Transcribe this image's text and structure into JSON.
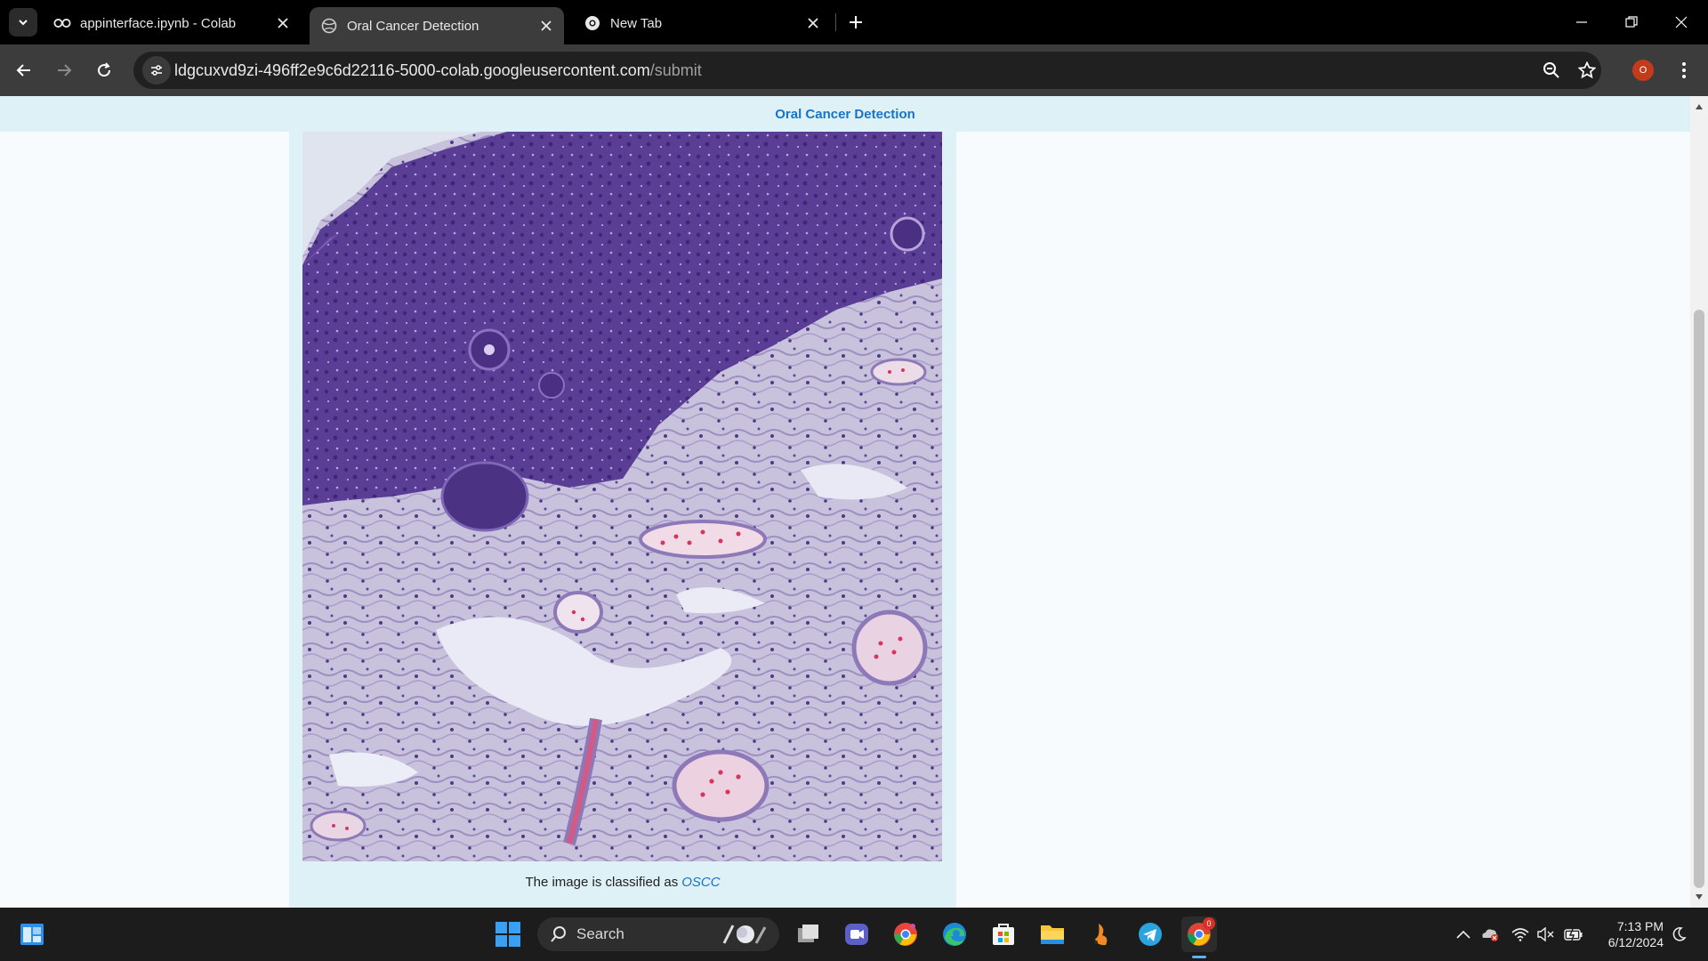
{
  "browser": {
    "tabs": [
      {
        "title": "appinterface.ipynb - Colab",
        "icon": "colab-icon",
        "active": false
      },
      {
        "title": "Oral Cancer Detection",
        "icon": "globe-icon",
        "active": true
      },
      {
        "title": "New Tab",
        "icon": "chrome-icon",
        "active": false
      }
    ],
    "url_host": "ldgcuxvd9zi-496ff2e9c6d22116-5000-colab.googleusercontent.com",
    "url_path": "/submit",
    "profile_initial": "O"
  },
  "page": {
    "header_title": "Oral Cancer Detection",
    "image_alt": "histopathology tissue image",
    "caption_prefix": "The image is classified as",
    "classification": "OSCC"
  },
  "taskbar": {
    "search_label": "Search",
    "apps": [
      "start-icon",
      "search-icon",
      "copilot-icon",
      "task-view-icon",
      "teams-icon",
      "chrome-canary-icon",
      "edge-icon",
      "store-icon",
      "file-explorer-icon",
      "app-icon",
      "telegram-icon",
      "chrome-icon"
    ],
    "chrome_badge": "0",
    "time": "7:13 PM",
    "date": "6/12/2024"
  },
  "colors": {
    "accent": "#1a73c8",
    "header_bg": "#ddf1f6",
    "card_bg": "#def1f6"
  }
}
